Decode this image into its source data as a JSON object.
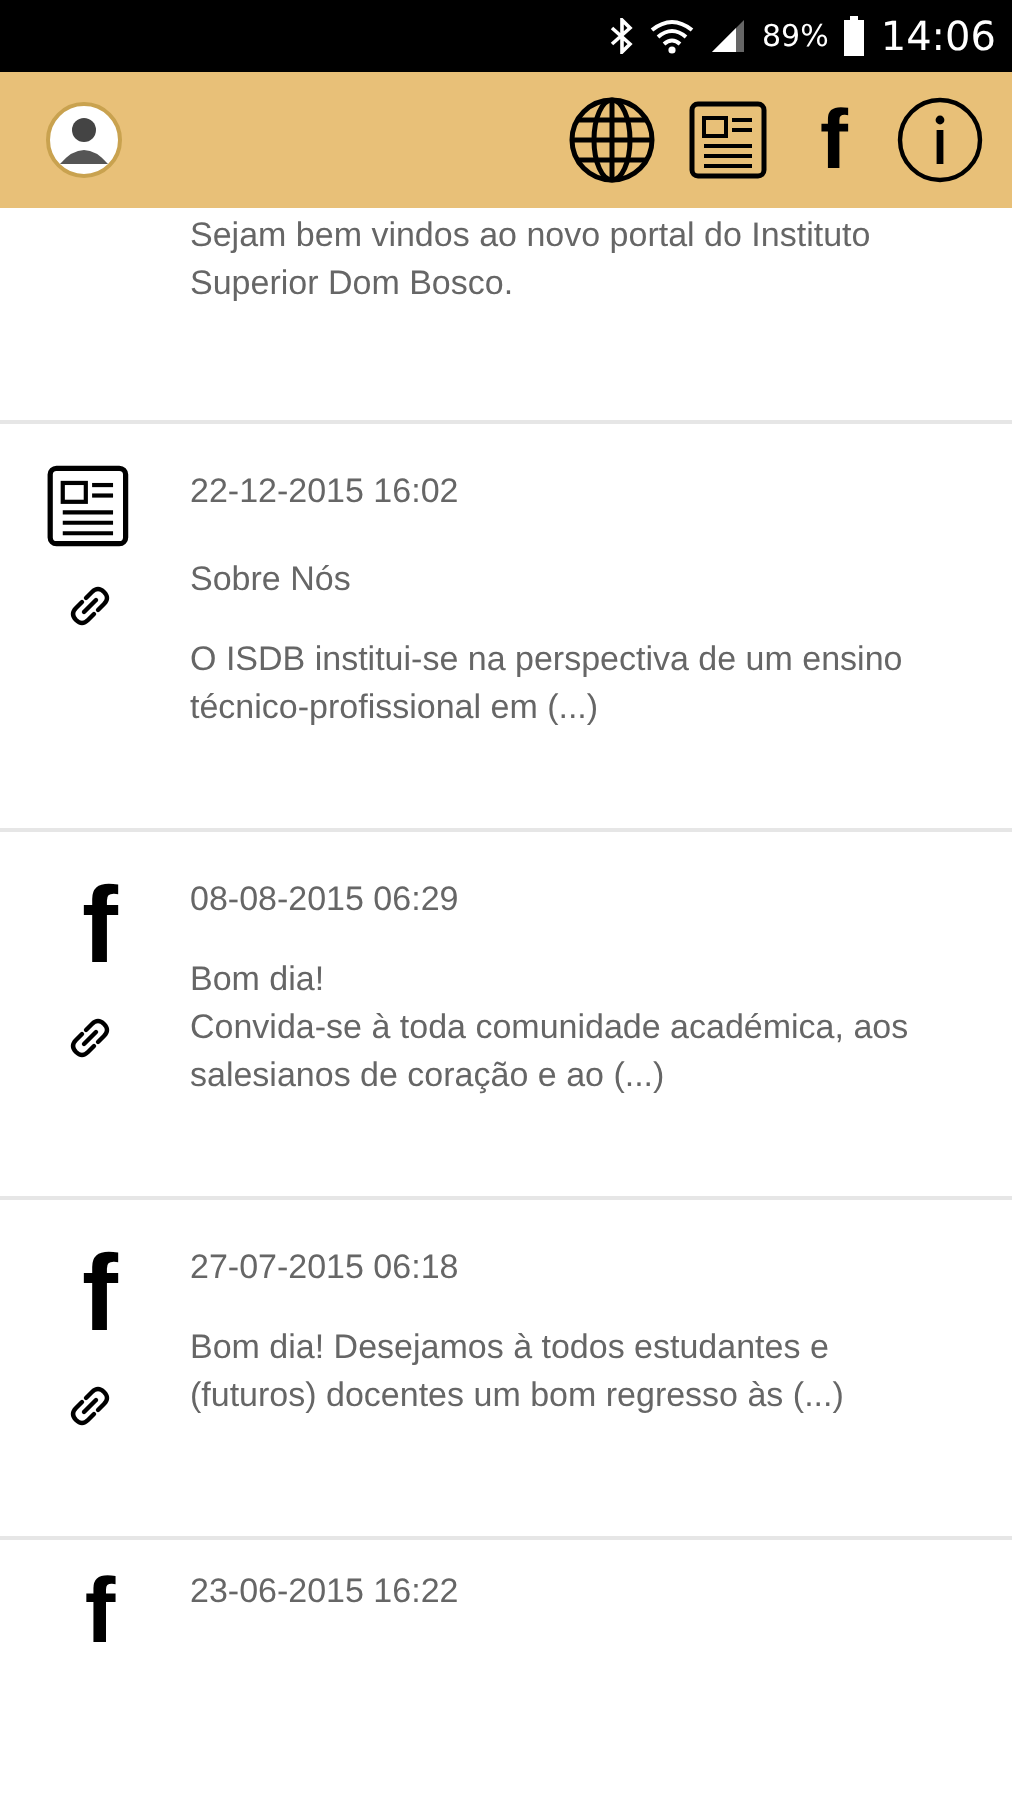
{
  "status_bar": {
    "battery": "89%",
    "time": "14:06"
  },
  "app_bar": {
    "actions": [
      {
        "kind": "globe"
      },
      {
        "kind": "news"
      },
      {
        "kind": "facebook",
        "glyph": "f"
      },
      {
        "kind": "info"
      }
    ]
  },
  "posts": [
    {
      "kind": "none",
      "text": "Sejam bem vindos ao novo portal do Instituto Superior Dom Bosco."
    },
    {
      "kind": "news",
      "date": "22-12-2015 16:02",
      "title": "Sobre Nós",
      "text": "O ISDB institui-se na perspectiva de um ensino técnico-profissional em (...)"
    },
    {
      "kind": "facebook",
      "glyph": "f",
      "date": "08-08-2015 06:29",
      "text": "Bom dia!\nConvida-se à toda comunidade académica, aos salesianos de coração e ao (...)"
    },
    {
      "kind": "facebook",
      "glyph": "f",
      "date": "27-07-2015 06:18",
      "text": "Bom dia! Desejamos à todos estudantes e (futuros) docentes um bom regresso às (...)"
    },
    {
      "kind": "facebook",
      "glyph": "f",
      "date": "23-06-2015 16:22"
    }
  ]
}
